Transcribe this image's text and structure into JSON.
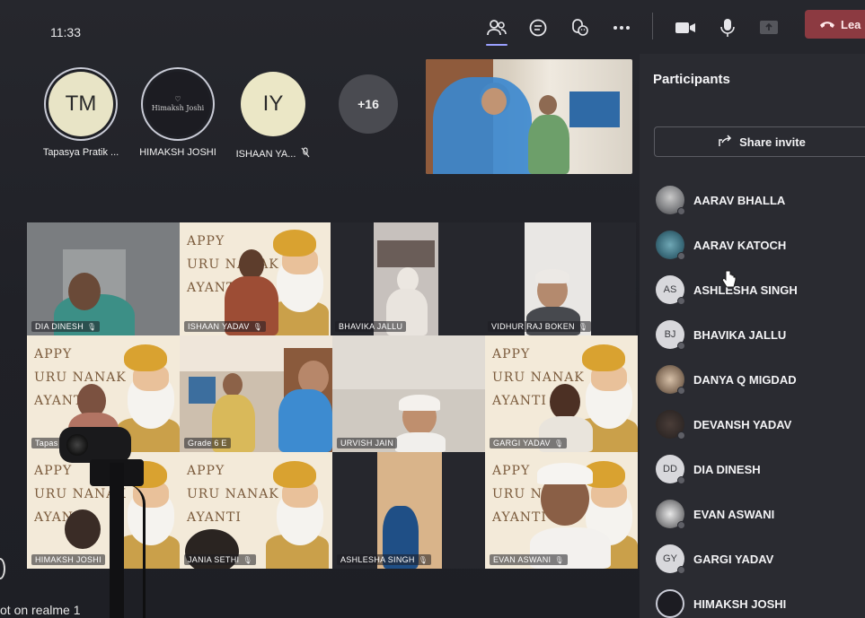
{
  "topbar": {
    "time": "11:33",
    "leave_label": "Lea",
    "icons": [
      "people-icon",
      "chat-icon",
      "reactions-icon",
      "more-icon",
      "camera-icon",
      "mic-icon",
      "share-icon"
    ]
  },
  "avatars": [
    {
      "initials": "TM",
      "name": "Tapasya Pratik ...",
      "bg": "#e8e4c6",
      "ring": true
    },
    {
      "initials": "",
      "logo_text": "Himaksh Joshi",
      "name": "HIMAKSH JOSHI",
      "bg": "#1c1c22",
      "ring": true
    },
    {
      "initials": "IY",
      "name": "ISHAAN YA...",
      "bg": "#ebe7c6",
      "ring": false,
      "muted": true
    },
    {
      "initials": "+16",
      "name": "",
      "bg": "#4a4b51",
      "ring": false
    }
  ],
  "grid": {
    "tiles": [
      {
        "name": "DIA DINESH"
      },
      {
        "name": "ISHAAN YADAV"
      },
      {
        "name": "BHAVIKA JALLU"
      },
      {
        "name": "VIDHUR RAJ BOKEN"
      },
      {
        "name": "Tapas"
      },
      {
        "name": "Grade 6 E"
      },
      {
        "name": "URVISH JAIN"
      },
      {
        "name": "GARGI YADAV"
      },
      {
        "name": "HIMAKSH JOSHI"
      },
      {
        "name": "JANIA SETHI"
      },
      {
        "name": "ASHLESHA SINGH"
      },
      {
        "name": "EVAN ASWANI"
      }
    ],
    "banner_lines": [
      "APPY",
      "URU NANAK",
      "AYANTI"
    ]
  },
  "panel": {
    "title": "Participants",
    "share_label": "Share invite",
    "participants": [
      {
        "initials": "",
        "name": "AARAV BHALLA",
        "photo": true
      },
      {
        "initials": "",
        "name": "AARAV KATOCH",
        "photo": true
      },
      {
        "initials": "AS",
        "name": "ASHLESHA SINGH",
        "photo": false
      },
      {
        "initials": "BJ",
        "name": "BHAVIKA JALLU",
        "photo": false
      },
      {
        "initials": "",
        "name": "DANYA Q MIGDAD",
        "photo": true
      },
      {
        "initials": "",
        "name": "DEVANSH YADAV",
        "photo": true
      },
      {
        "initials": "DD",
        "name": "DIA DINESH",
        "photo": false
      },
      {
        "initials": "",
        "name": "EVAN ASWANI",
        "photo": true
      },
      {
        "initials": "GY",
        "name": "GARGI YADAV",
        "photo": false
      },
      {
        "initials": "",
        "name": "HIMAKSH JOSHI",
        "photo": true
      }
    ]
  },
  "bezel": {
    "text": "ot on realme 1"
  }
}
